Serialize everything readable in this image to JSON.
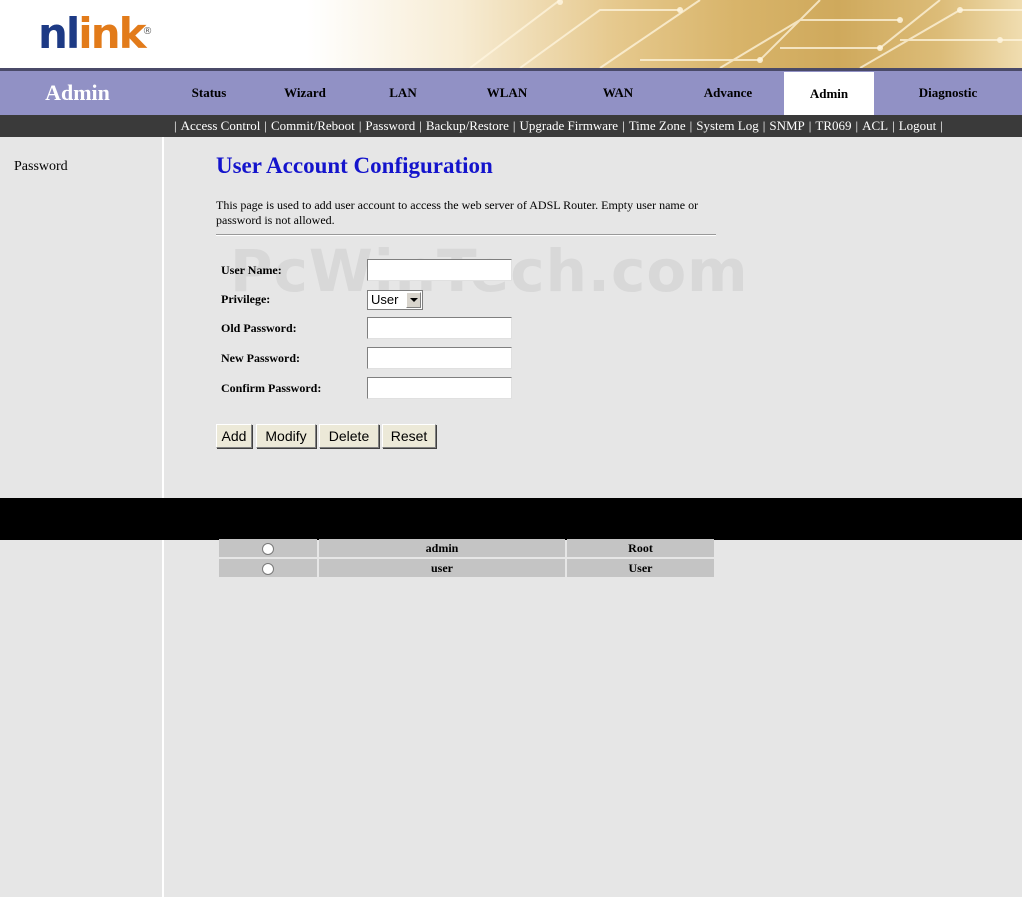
{
  "brand": {
    "logo_main": "nl",
    "logo_accent": "ink",
    "registered": "®"
  },
  "colors": {
    "nav_bg": "#9191c5",
    "subnav_bg": "#3a3a3a",
    "title_blue": "#1414cc",
    "logo_blue": "#1d3a85",
    "logo_orange": "#e27b1a"
  },
  "header": {
    "section_title": "Admin",
    "active_tab": "Admin"
  },
  "nav": [
    {
      "label": "Status"
    },
    {
      "label": "Wizard"
    },
    {
      "label": "LAN"
    },
    {
      "label": "WLAN"
    },
    {
      "label": "WAN"
    },
    {
      "label": "Advance"
    },
    {
      "label": "Admin"
    },
    {
      "label": "Diagnostic"
    }
  ],
  "subnav": [
    "Access Control",
    "Commit/Reboot",
    "Password",
    "Backup/Restore",
    "Upgrade Firmware",
    "Time Zone",
    "System Log",
    "SNMP",
    "TR069",
    "ACL",
    "Logout"
  ],
  "sidebar": {
    "items": [
      {
        "label": "Password"
      }
    ]
  },
  "main": {
    "title": "User Account Configuration",
    "description": "This page is used to add user account to access the web server of ADSL Router. Empty user name or password is not allowed.",
    "watermark": "PcWinTech.com"
  },
  "form": {
    "user_name_label": "User Name:",
    "user_name_value": "",
    "privilege_label": "Privilege:",
    "privilege_value": "User",
    "old_password_label": "Old Password:",
    "old_password_value": "",
    "new_password_label": "New Password:",
    "new_password_value": "",
    "confirm_password_label": "Confirm Password:",
    "confirm_password_value": ""
  },
  "buttons": {
    "add": "Add",
    "modify": "Modify",
    "delete": "Delete",
    "reset": "Reset"
  },
  "users": [
    {
      "name": "admin",
      "privilege": "Root"
    },
    {
      "name": "user",
      "privilege": "User"
    }
  ]
}
